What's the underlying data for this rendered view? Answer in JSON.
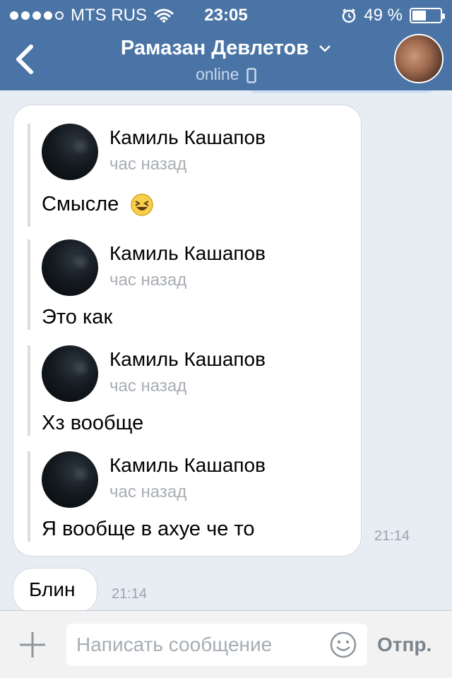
{
  "status_bar": {
    "carrier": "MTS RUS",
    "time": "23:05",
    "battery_text": "49 %",
    "battery_level": 0.49,
    "signal_bars": 5,
    "signal_filled": 4
  },
  "header": {
    "contact_name": "Рамазан Девлетов",
    "status": "online"
  },
  "forwarded_messages": [
    {
      "author": "Камиль Кашапов",
      "time": "час назад",
      "text": "Смысле",
      "emoji": "laughing-emoji"
    },
    {
      "author": "Камиль Кашапов",
      "time": "час назад",
      "text": "Это как"
    },
    {
      "author": "Камиль Кашапов",
      "time": "час назад",
      "text": "Хз вообще"
    },
    {
      "author": "Камиль Кашапов",
      "time": "час назад",
      "text": "Я вообще в ахуе че то"
    }
  ],
  "forward_bubble_time": "21:14",
  "message": {
    "text": "Блин",
    "time": "21:14"
  },
  "input_bar": {
    "placeholder": "Написать сообщение",
    "send_label": "Отпр."
  },
  "colors": {
    "header_bg": "#4a74a6",
    "chat_bg": "#e8edf4",
    "bubble_bg": "#ffffff",
    "meta_text": "#a8adb3"
  }
}
